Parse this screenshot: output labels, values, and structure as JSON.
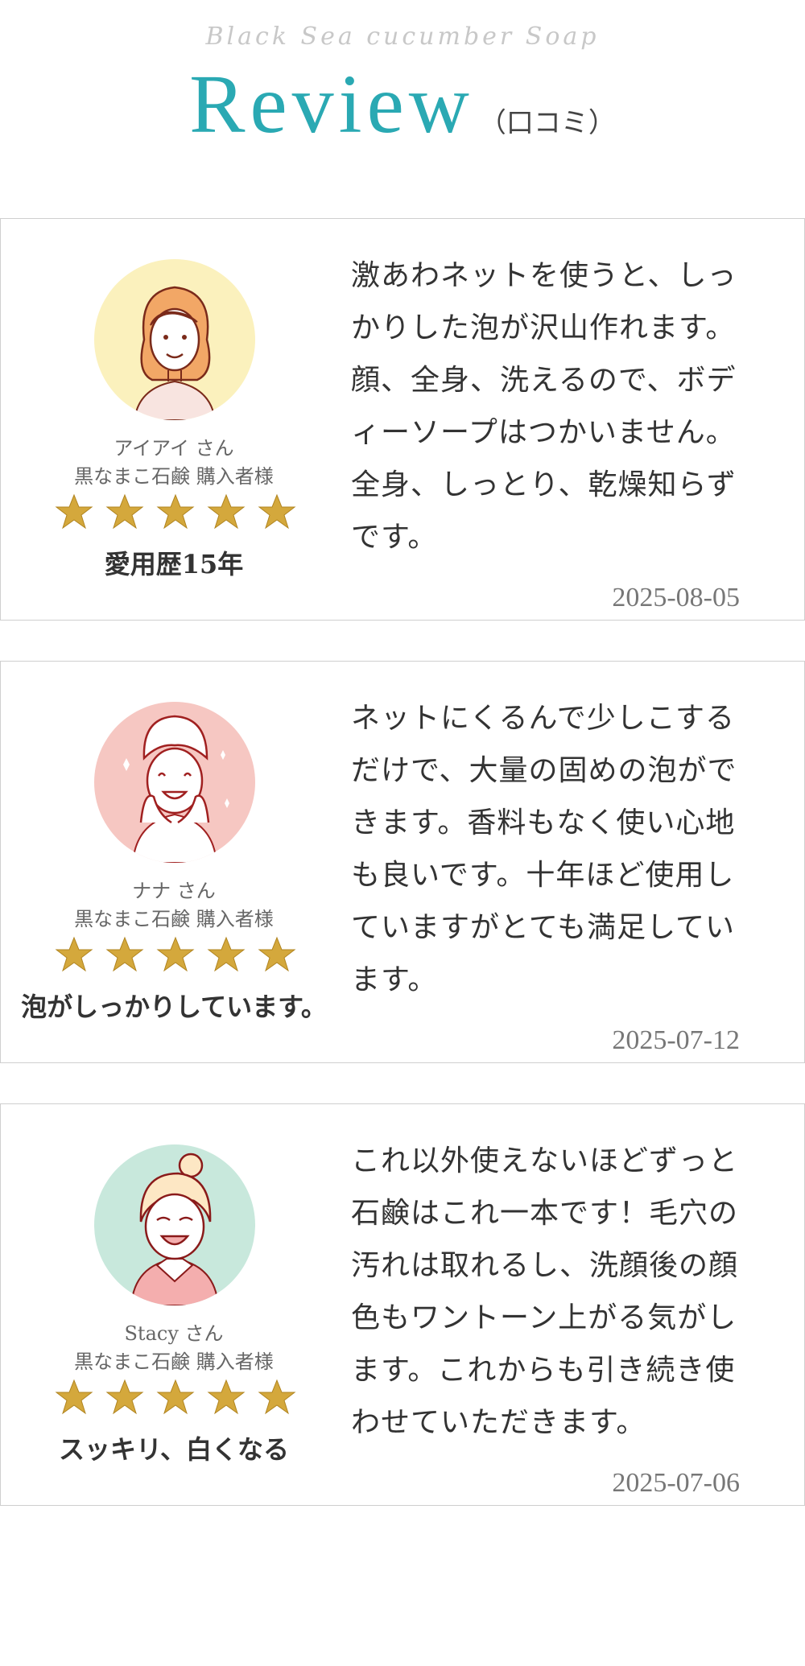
{
  "header": {
    "subtitle": "Black Sea cucumber Soap",
    "title": "Review",
    "title_suffix": "（口コミ）"
  },
  "colors": {
    "accent": "#2aa9b3",
    "star_gold": "#d4a83c",
    "avatar_bg_1": "#fbf1bd",
    "avatar_bg_2": "#f6c7c2",
    "avatar_bg_3": "#c8e8dc"
  },
  "reviews": [
    {
      "name": "アイアイ さん",
      "buyer": "黒なまこ石鹸 購入者様",
      "rating": 5,
      "tagline": "愛用歴15年",
      "text": "激あわネットを使うと、しっかりした泡が沢山作れます。顔、全身、洗えるので、ボディーソープはつかいません。全身、しっとり、乾燥知らずです。",
      "date": "2025-08-05",
      "avatar_icon": "woman-wavy-hair-icon"
    },
    {
      "name": "ナナ さん",
      "buyer": "黒なまこ石鹸 購入者様",
      "rating": 5,
      "tagline": "泡がしっかりしています。",
      "text": "ネットにくるんで少しこするだけで、大量の固めの泡ができます。香料もなく使い心地も良いです。十年ほど使用していますがとても満足しています。",
      "date": "2025-07-12",
      "avatar_icon": "woman-towel-hair-icon"
    },
    {
      "name": "Stacy さん",
      "buyer": "黒なまこ石鹸 購入者様",
      "rating": 5,
      "tagline": "スッキリ、白くなる",
      "text": "これ以外使えないほどずっと石鹸はこれ一本です！毛穴の汚れは取れるし、洗顔後の顔色もワントーン上がる気がします。これからも引き続き使わせていただきます。",
      "date": "2025-07-06",
      "avatar_icon": "woman-bun-hair-icon"
    }
  ]
}
